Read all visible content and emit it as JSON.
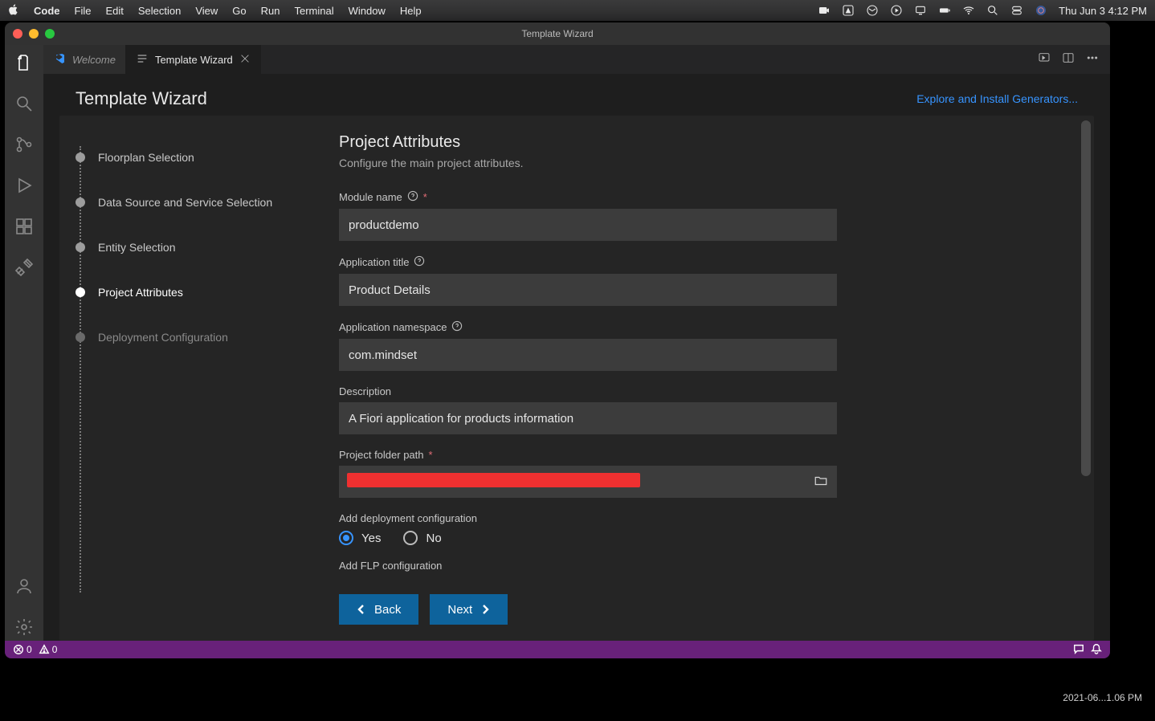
{
  "menubar": {
    "app": "Code",
    "items": [
      "File",
      "Edit",
      "Selection",
      "View",
      "Go",
      "Run",
      "Terminal",
      "Window",
      "Help"
    ],
    "clock": "Thu Jun 3  4:12 PM"
  },
  "window": {
    "title": "Template Wizard"
  },
  "tabs": {
    "welcome_label": "Welcome",
    "wizard_label": "Template Wizard"
  },
  "wizard": {
    "title": "Template Wizard",
    "explore_link": "Explore and Install Generators...",
    "steps": [
      "Floorplan Selection",
      "Data Source and Service Selection",
      "Entity Selection",
      "Project Attributes",
      "Deployment Configuration"
    ]
  },
  "form": {
    "heading": "Project Attributes",
    "subtitle": "Configure the main project attributes.",
    "module_name_label": "Module name",
    "module_name_value": "productdemo",
    "app_title_label": "Application title",
    "app_title_value": "Product Details",
    "namespace_label": "Application namespace",
    "namespace_value": "com.mindset",
    "description_label": "Description",
    "description_value": "A Fiori application for products information",
    "folder_label": "Project folder path",
    "folder_value": "",
    "deploy_label": "Add deployment configuration",
    "flp_label": "Add FLP configuration",
    "yes": "Yes",
    "no": "No"
  },
  "buttons": {
    "back": "Back",
    "next": "Next"
  },
  "statusbar": {
    "errors": "0",
    "warnings": "0"
  },
  "dock": {
    "timestamp": "2021-06...1.06 PM"
  }
}
